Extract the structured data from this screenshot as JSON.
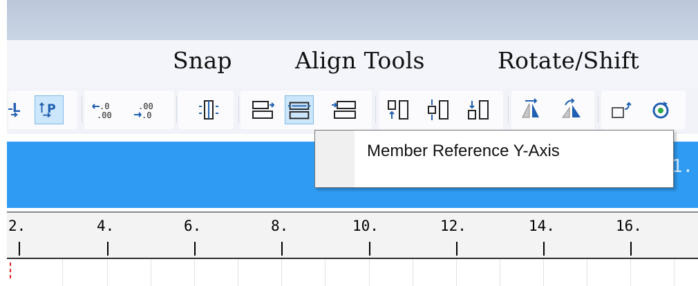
{
  "menu": {
    "items": [
      {
        "label": "Snap"
      },
      {
        "label": "Align Tools"
      },
      {
        "label": "Rotate/Shift"
      }
    ]
  },
  "toolbar": {
    "buttons": [
      {
        "name": "snap-left-icon",
        "selected": false
      },
      {
        "name": "snap-point-icon",
        "selected": false
      },
      {
        "name": "decimal-decrease-icon",
        "selected": false
      },
      {
        "name": "decimal-increase-icon",
        "selected": false
      },
      {
        "name": "center-vertical-icon",
        "selected": false
      },
      {
        "name": "member-reference-x-axis-icon",
        "selected": false
      },
      {
        "name": "member-reference-y-axis-icon",
        "selected": true
      },
      {
        "name": "member-reference-z-axis-icon",
        "selected": false
      },
      {
        "name": "align-top-icon",
        "selected": false
      },
      {
        "name": "align-middle-icon",
        "selected": false
      },
      {
        "name": "align-bottom-icon",
        "selected": false
      },
      {
        "name": "mirror-horizontal-icon",
        "selected": false
      },
      {
        "name": "mirror-vertical-icon",
        "selected": false
      },
      {
        "name": "shift-icon",
        "selected": false
      },
      {
        "name": "rotate-icon",
        "selected": false
      }
    ]
  },
  "tooltip": {
    "text": "Member Reference Y-Axis"
  },
  "panel": {
    "right_fragment": "1. "
  },
  "ruler": {
    "labels": [
      "2.",
      "4.",
      "6.",
      "8.",
      "10.",
      "12.",
      "14.",
      "16."
    ]
  },
  "colors": {
    "accent": "#2f9bf2",
    "selected_bg": "#cce6fb",
    "selected_border": "#7fb8e8",
    "icon_blue": "#1f5fb0",
    "red_mark": "#e02020"
  }
}
